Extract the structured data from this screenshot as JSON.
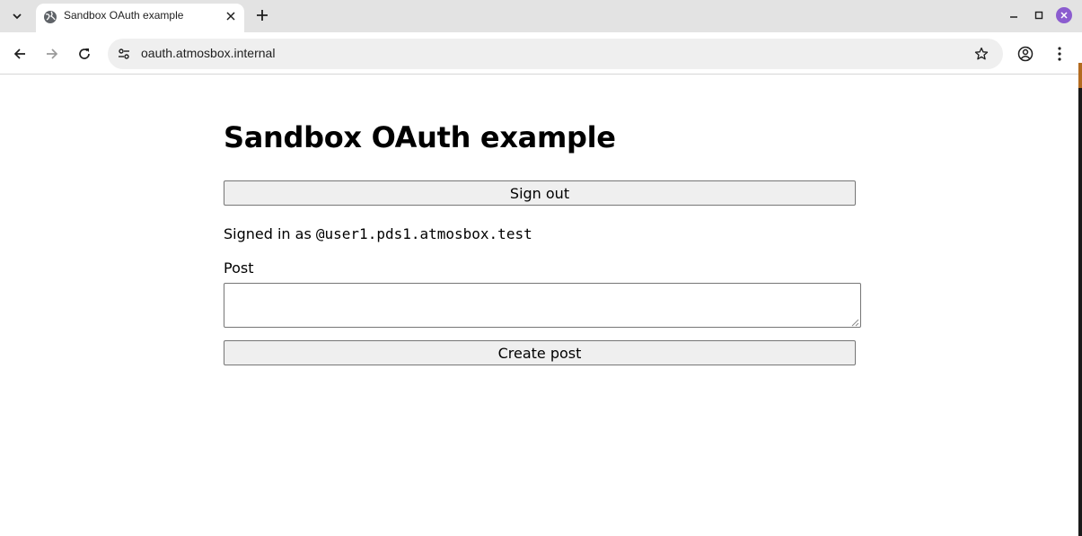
{
  "browser": {
    "tab": {
      "title": "Sandbox OAuth example",
      "favicon": "globe-icon"
    },
    "address_bar": {
      "url": "oauth.atmosbox.internal"
    },
    "colors": {
      "close_button": "#8b5ccf",
      "tabstrip": "#e3e3e3",
      "omnibox": "#efefef"
    }
  },
  "page": {
    "title": "Sandbox OAuth example",
    "sign_out_label": "Sign out",
    "signed_in_prefix": "Signed in as ",
    "handle": "@user1.pds1.atmosbox.test",
    "post_label": "Post",
    "post_value": "",
    "create_post_label": "Create post"
  }
}
